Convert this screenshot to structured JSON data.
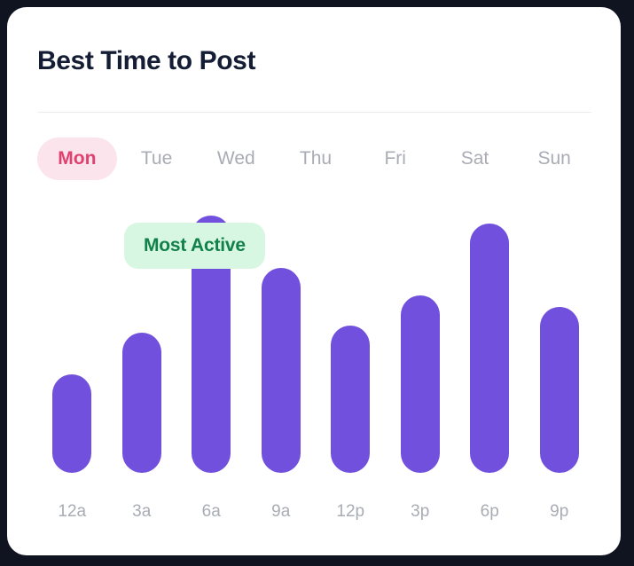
{
  "card": {
    "title": "Best Time to Post"
  },
  "day_tabs": {
    "active_index": 0,
    "items": [
      {
        "label": "Mon"
      },
      {
        "label": "Tue"
      },
      {
        "label": "Wed"
      },
      {
        "label": "Thu"
      },
      {
        "label": "Fri"
      },
      {
        "label": "Sat"
      },
      {
        "label": "Sun"
      }
    ]
  },
  "badge": {
    "label": "Most Active"
  },
  "colors": {
    "bar": "#7150dd",
    "active_tab_bg": "#fce4ec",
    "active_tab_text": "#e0416f",
    "badge_bg": "#d7f7e3",
    "badge_text": "#128049",
    "title_text": "#141d34",
    "muted_text": "#a9acb4",
    "card_bg": "#ffffff",
    "page_bg": "#0f1420"
  },
  "chart_data": {
    "type": "bar",
    "title": "Best Time to Post",
    "xlabel": "",
    "ylabel": "",
    "grid": false,
    "legend": null,
    "categories": [
      "12a",
      "3a",
      "6a",
      "9a",
      "12p",
      "3p",
      "6p",
      "9p"
    ],
    "values": [
      84,
      120,
      220,
      175,
      126,
      152,
      213,
      142
    ],
    "ylim": [
      0,
      230
    ],
    "annotations": [
      {
        "text": "Most Active",
        "category": "6a"
      }
    ]
  }
}
